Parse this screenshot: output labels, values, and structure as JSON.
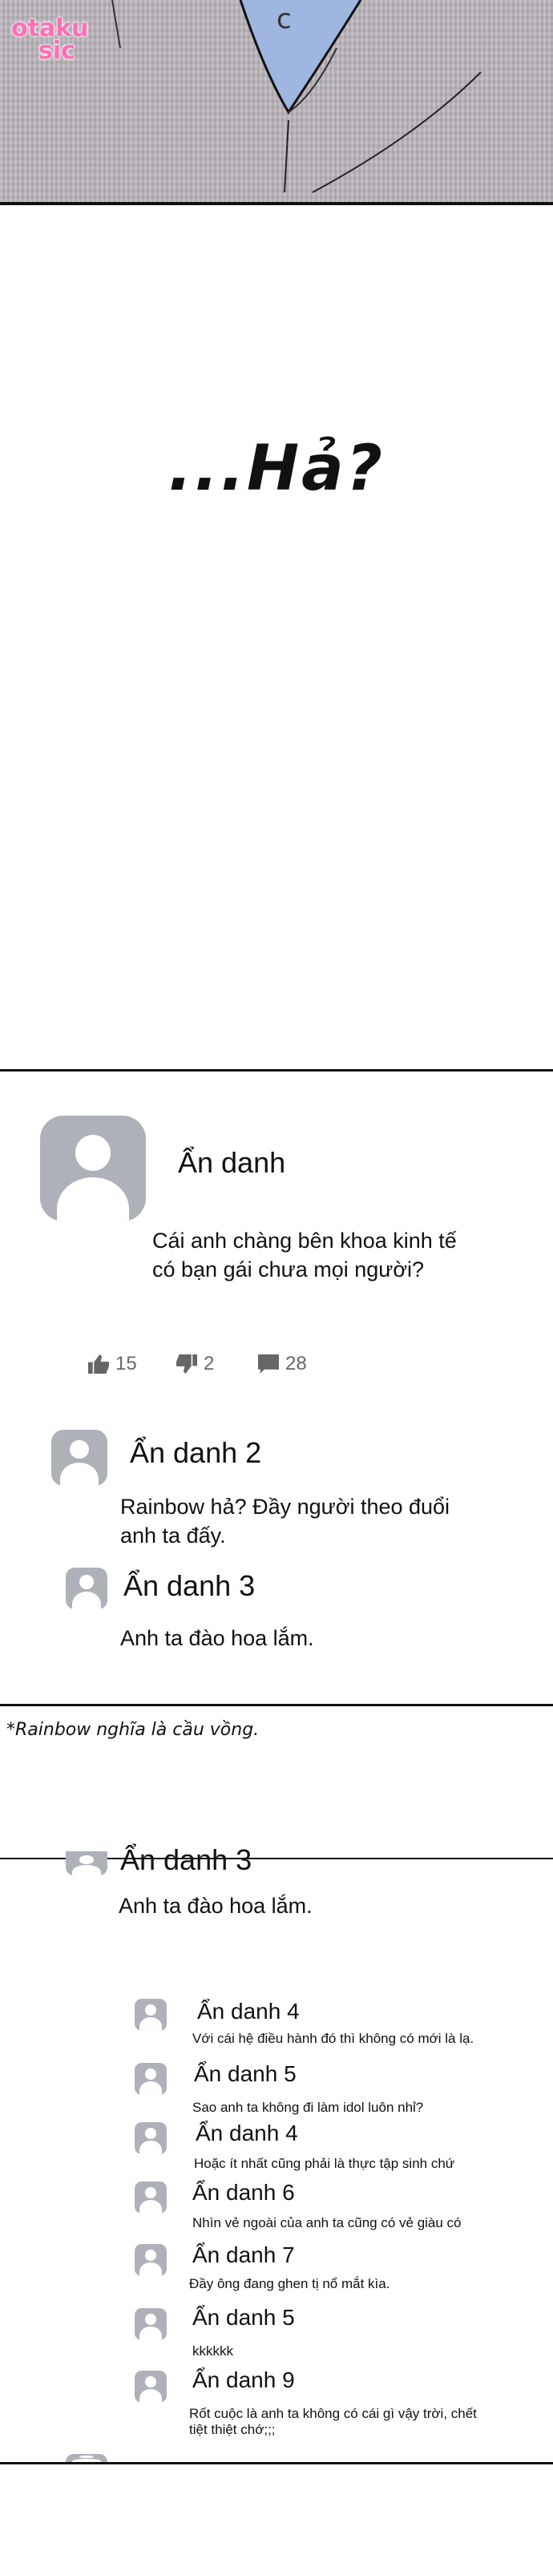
{
  "watermark": {
    "line1": "otaku",
    "line2": "sic"
  },
  "panel_text": "...Hả?",
  "post": {
    "author": "Ẩn danh",
    "text_line1": "Cái anh chàng bên khoa kinh tế",
    "text_line2": "có bạn gái chưa mọi người?",
    "likes": "15",
    "dislikes": "2",
    "comments": "28"
  },
  "replies": [
    {
      "author": "Ẩn danh 2",
      "line1": "Rainbow hả?  Đầy người theo đuổi",
      "line2": "anh ta đấy."
    },
    {
      "author": "Ẩn danh 3",
      "line1": "Anh ta đào hoa lắm.",
      "line2": ""
    }
  ],
  "footnote": "*Rainbow nghĩa là cầu vồng.",
  "cutoff_author": "Ẩn danh 3",
  "cutoff_text": "Anh ta đào hoa lắm.",
  "thread": [
    {
      "author": "Ẩn danh 4",
      "text": "Với cái hệ điều hành đó thì không có mới là lạ."
    },
    {
      "author": "Ẩn danh 5",
      "text": "Sao anh ta không đi làm idol luôn nhỉ?"
    },
    {
      "author": "Ẩn danh 4",
      "text": "Hoặc ít nhất cũng phải là thực tập sinh chứ"
    },
    {
      "author": "Ẩn danh 6",
      "text": "Nhìn vẻ ngoài của anh ta cũng có vẻ giàu có"
    },
    {
      "author": "Ẩn danh 7",
      "text": "Đầy ông đang ghen tị nổ mắt kìa."
    },
    {
      "author": "Ẩn danh 5",
      "text": "kkkkkk"
    },
    {
      "author": "Ẩn danh 9",
      "text": "Rốt cuộc là anh ta không có cái gì vậy trời, chết",
      "text2": "tiệt thiệt chớ;;;"
    }
  ]
}
